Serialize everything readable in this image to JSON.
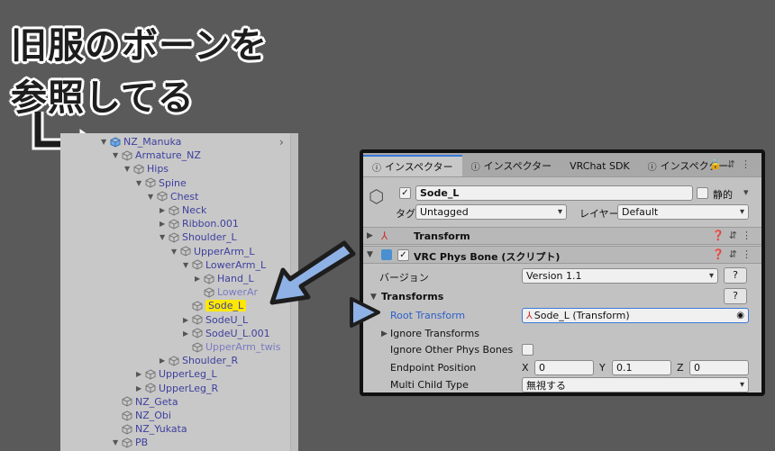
{
  "overlay": {
    "line1": "旧服のボーンを",
    "line2": "参照してる"
  },
  "hierarchy": {
    "rows": [
      {
        "label": "NZ_Manuka",
        "arrow": "▼",
        "depth": 0,
        "icon": "prefab-cube-icon"
      },
      {
        "label": "Armature_NZ",
        "arrow": "▼",
        "depth": 1,
        "icon": "cube-icon"
      },
      {
        "label": "Hips",
        "arrow": "▼",
        "depth": 2,
        "icon": "cube-icon"
      },
      {
        "label": "Spine",
        "arrow": "▼",
        "depth": 3,
        "icon": "cube-icon"
      },
      {
        "label": "Chest",
        "arrow": "▼",
        "depth": 4,
        "icon": "cube-icon"
      },
      {
        "label": "Neck",
        "arrow": "▶",
        "depth": 5,
        "icon": "cube-icon"
      },
      {
        "label": "Ribbon.001",
        "arrow": "▶",
        "depth": 5,
        "icon": "cube-icon"
      },
      {
        "label": "Shoulder_L",
        "arrow": "▼",
        "depth": 5,
        "icon": "cube-icon"
      },
      {
        "label": "UpperArm_L",
        "arrow": "▼",
        "depth": 6,
        "icon": "cube-icon"
      },
      {
        "label": "LowerArm_L",
        "arrow": "▼",
        "depth": 7,
        "icon": "cube-icon"
      },
      {
        "label": "Hand_L",
        "arrow": "▶",
        "depth": 8,
        "icon": "cube-icon"
      },
      {
        "label": "LowerAr",
        "arrow": "",
        "depth": 8,
        "icon": "cube-icon",
        "dim": true
      },
      {
        "label": "Sode_L",
        "arrow": "",
        "depth": 7,
        "icon": "cube-icon",
        "highlight": true
      },
      {
        "label": "SodeU_L",
        "arrow": "▶",
        "depth": 7,
        "icon": "cube-icon"
      },
      {
        "label": "SodeU_L.001",
        "arrow": "▶",
        "depth": 7,
        "icon": "cube-icon"
      },
      {
        "label": "UpperArm_twis",
        "arrow": "",
        "depth": 7,
        "icon": "cube-icon",
        "dim": true
      },
      {
        "label": "Shoulder_R",
        "arrow": "▶",
        "depth": 5,
        "icon": "cube-icon"
      },
      {
        "label": "UpperLeg_L",
        "arrow": "▶",
        "depth": 3,
        "icon": "cube-icon"
      },
      {
        "label": "UpperLeg_R",
        "arrow": "▶",
        "depth": 3,
        "icon": "cube-icon"
      },
      {
        "label": "NZ_Geta",
        "arrow": "",
        "depth": 1,
        "icon": "cube-icon"
      },
      {
        "label": "NZ_Obi",
        "arrow": "",
        "depth": 1,
        "icon": "cube-icon"
      },
      {
        "label": "NZ_Yukata",
        "arrow": "",
        "depth": 1,
        "icon": "cube-icon"
      },
      {
        "label": "PB",
        "arrow": "▼",
        "depth": 1,
        "icon": "cube-icon"
      }
    ]
  },
  "inspector": {
    "tabs": [
      {
        "label": "インスペクター",
        "icon": "info-icon",
        "active": true
      },
      {
        "label": "インスペクター",
        "icon": "info-icon",
        "active": false
      },
      {
        "label": "VRChat SDK",
        "icon": "",
        "active": false
      },
      {
        "label": "インスペクター",
        "icon": "info-icon",
        "active": false
      }
    ],
    "object_name": "Sode_L",
    "static_label": "静的",
    "tag_label": "タグ",
    "tag_value": "Untagged",
    "layer_label": "レイヤー",
    "layer_value": "Default",
    "transform_header": "Transform",
    "physbone_header": "VRC Phys Bone (スクリプト)",
    "version_label": "バージョン",
    "version_value": "Version 1.1",
    "q_label": "?",
    "transforms_section": "Transforms",
    "root_transform_label": "Root Transform",
    "root_transform_value": "Sode_L (Transform)",
    "ignore_transforms_label": "Ignore Transforms",
    "ignore_other_label": "Ignore Other Phys Bones",
    "endpoint_label": "Endpoint Position",
    "endpoint_x_label": "X",
    "endpoint_x": "0",
    "endpoint_y_label": "Y",
    "endpoint_y": "0.1",
    "endpoint_z_label": "Z",
    "endpoint_z": "0",
    "multi_child_label": "Multi Child Type",
    "multi_child_value": "無視する"
  },
  "colors": {
    "highlight": "#ffe800",
    "arrow_blue": "#8fb2e6",
    "link_blue": "#2c5fc9"
  }
}
